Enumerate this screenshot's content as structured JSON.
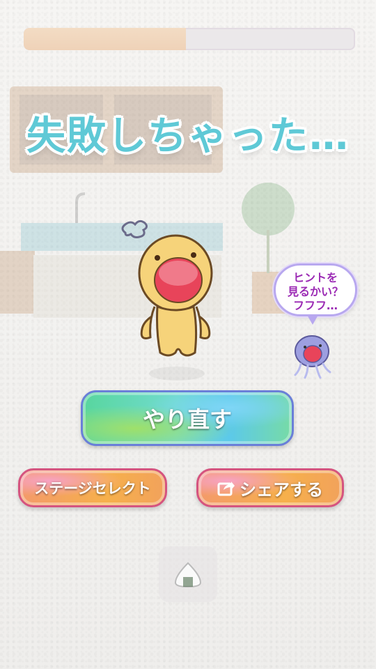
{
  "progress": {
    "value": 0.49
  },
  "title": "失敗しちゃった…",
  "hint_bubble": {
    "line1": "ヒントを",
    "line2": "見るかい？",
    "line3": "フフフ…"
  },
  "buttons": {
    "retry_label": "やり直す",
    "stage_select_label": "ステージセレクト",
    "share_label": "シェアする"
  },
  "icons": {
    "share": "share-icon",
    "onigiri": "onigiri-icon",
    "sigh": "sigh-puff-icon"
  },
  "colors": {
    "title": "#5fc9d6",
    "bubble_text": "#9b2ab4",
    "retry_border": "#6a7fd8",
    "orange_border": "#d5547f"
  }
}
